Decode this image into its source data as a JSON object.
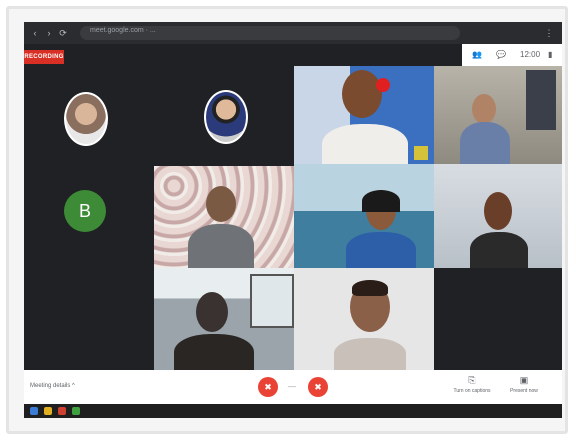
{
  "browser": {
    "url": "meet.google.com · ...",
    "nav_back": "‹",
    "nav_forward": "›",
    "nav_reload": "⟳"
  },
  "meet": {
    "recording_label": "RECORDING",
    "avatar_initial": "B",
    "top_controls": {
      "people_icon": "people-icon",
      "chat_icon": "chat-icon",
      "time_label": "12:00"
    },
    "bottom": {
      "meeting_info": "Meeting details ^",
      "mic_icon": "mic-icon",
      "end_call_icon": "end-call-icon",
      "camera_icon": "camera-icon",
      "captions_label": "Turn on captions",
      "present_label": "Present now"
    }
  },
  "colors": {
    "meet_bg": "#202124",
    "recording": "#d93025",
    "end_call": "#ea4335",
    "avatar_b": "#3d8b37"
  }
}
